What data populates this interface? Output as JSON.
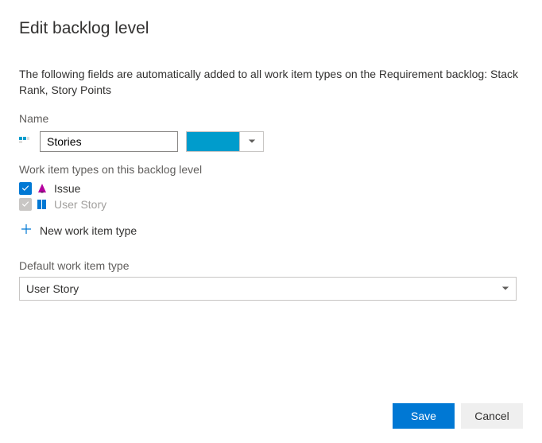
{
  "title": "Edit backlog level",
  "description": "The following fields are automatically added to all work item types on the Requirement backlog: Stack Rank, Story Points",
  "name_label": "Name",
  "name_value": "Stories",
  "color_hex": "#009ccc",
  "wit_section_label": "Work item types on this backlog level",
  "work_item_types": [
    {
      "name": "Issue",
      "checked": true,
      "disabled": false
    },
    {
      "name": "User Story",
      "checked": true,
      "disabled": true
    }
  ],
  "new_wit_label": "New work item type",
  "default_label": "Default work item type",
  "default_value": "User Story",
  "buttons": {
    "save": "Save",
    "cancel": "Cancel"
  }
}
